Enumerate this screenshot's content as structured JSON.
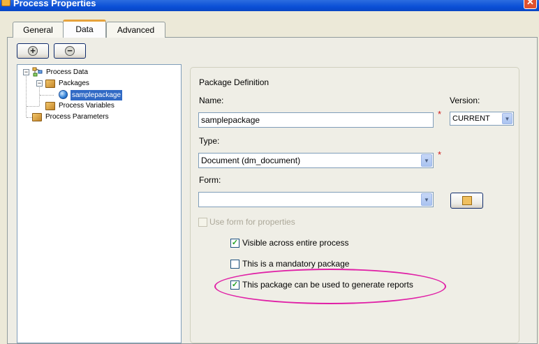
{
  "window": {
    "title": "Process Properties",
    "close_symbol": "✕"
  },
  "tabs": [
    {
      "label": "General",
      "active": false
    },
    {
      "label": "Data",
      "active": true
    },
    {
      "label": "Advanced",
      "active": false
    }
  ],
  "toolbar": {
    "add_symbol": "+",
    "remove_symbol": "−"
  },
  "tree": {
    "items": [
      {
        "label": "Process Data",
        "icon": "process-data-icon",
        "expanded": true
      },
      {
        "label": "Packages",
        "icon": "package-icon",
        "expanded": true
      },
      {
        "label": "samplepackage",
        "icon": "globe-icon",
        "selected": true
      },
      {
        "label": "Process Variables",
        "icon": "package-icon"
      },
      {
        "label": "Process Parameters",
        "icon": "package-icon"
      }
    ]
  },
  "package_definition": {
    "heading": "Package Definition",
    "name_label": "Name:",
    "name_value": "samplepackage",
    "version_label": "Version:",
    "version_value": "CURRENT",
    "type_label": "Type:",
    "type_value": "Document (dm_document)",
    "form_label": "Form:",
    "form_value": "",
    "required_mark": "*",
    "use_form_label": "Use form for properties",
    "use_form_checked": false,
    "visible_label": "Visible across entire process",
    "visible_checked": true,
    "mandatory_label": "This is a mandatory package",
    "mandatory_checked": false,
    "reports_label": "This package can be used to generate reports",
    "reports_checked": true,
    "check_mark": "✓"
  },
  "colors": {
    "annotation_ellipse": "#e01fa6",
    "required": "#d01818",
    "accent_tab": "#e6a23c"
  }
}
